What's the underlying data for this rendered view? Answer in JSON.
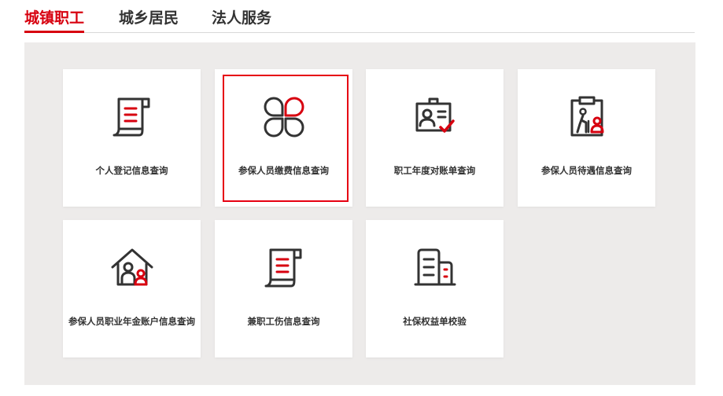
{
  "tabs": [
    {
      "label": "城镇职工",
      "active": true
    },
    {
      "label": "城乡居民",
      "active": false
    },
    {
      "label": "法人服务",
      "active": false
    }
  ],
  "cards": [
    {
      "label": "个人登记信息查询",
      "icon": "scroll-document-icon"
    },
    {
      "label": "参保人员缴费信息查询",
      "icon": "four-petal-icon",
      "selected": true
    },
    {
      "label": "职工年度对账单查询",
      "icon": "id-badge-check-icon"
    },
    {
      "label": "参保人员待遇信息查询",
      "icon": "clipboard-elder-icon"
    },
    {
      "label": "参保人员职业年金账户信息查询",
      "icon": "house-person-icon"
    },
    {
      "label": "兼职工伤信息查询",
      "icon": "scroll-document-icon"
    },
    {
      "label": "社保权益单校验",
      "icon": "buildings-icon"
    }
  ],
  "colors": {
    "accent": "#d7000f",
    "icon_stroke": "#333333",
    "panel_bg": "#edebea"
  }
}
